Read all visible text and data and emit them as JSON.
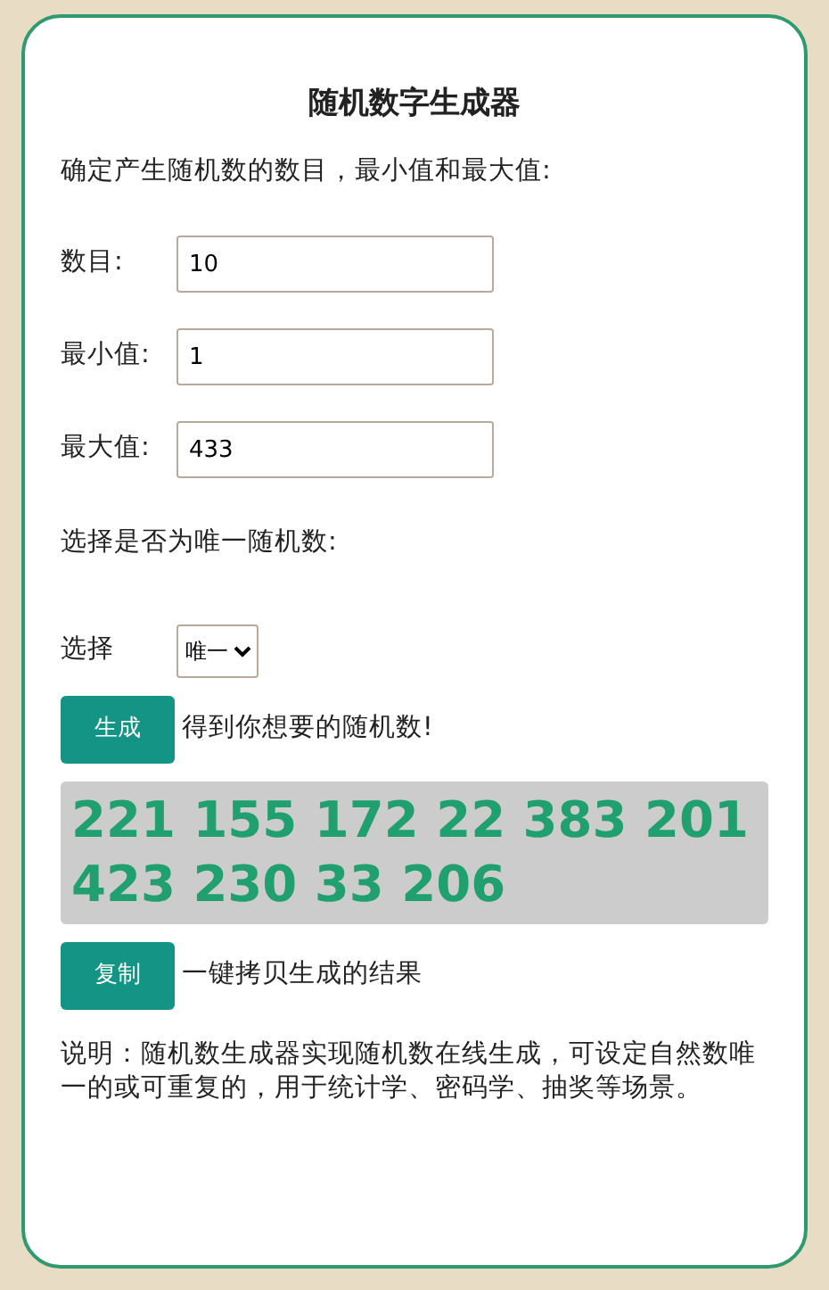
{
  "title": "随机数字生成器",
  "intro": "确定产生随机数的数目，最小值和最大值:",
  "fields": [
    {
      "label": "数目:",
      "value": "10"
    },
    {
      "label": "最小值:",
      "value": "1"
    },
    {
      "label": "最大值:",
      "value": "433"
    }
  ],
  "unique_prompt": "选择是否为唯一随机数:",
  "select": {
    "label": "选择",
    "value": "唯一"
  },
  "generate": {
    "button": "生成",
    "hint": "得到你想要的随机数!"
  },
  "result": "221 155 172 22 383 201 423 230 33 206",
  "copy": {
    "button": "复制",
    "hint": "一键拷贝生成的结果"
  },
  "description": "说明：随机数生成器实现随机数在线生成，可设定自然数唯一的或可重复的，用于统计学、密码学、抽奖等场景。"
}
